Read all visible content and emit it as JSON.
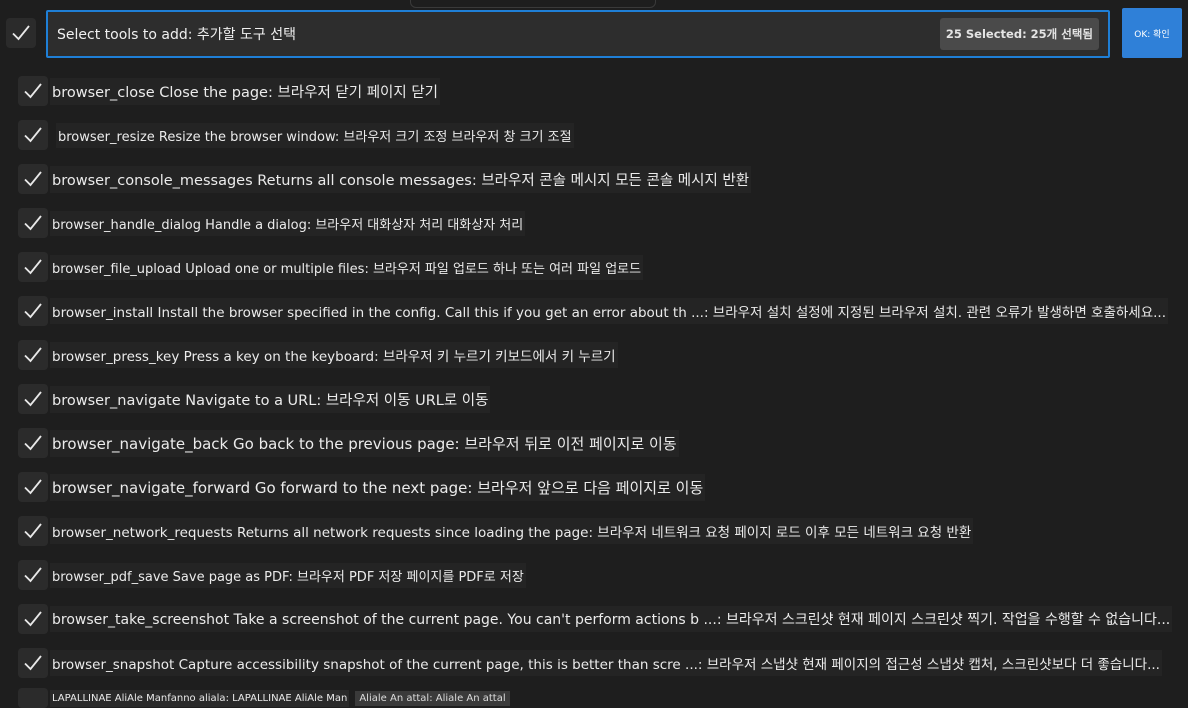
{
  "header": {
    "search_value": "Select tools to add: 추가할 도구 선택",
    "selected_badge": "25 Selected: 25개 선택됨",
    "ok_label": "OK: 확인"
  },
  "tools": [
    {
      "label": "browser_close Close the page: 브라우저 닫기 페이지 닫기"
    },
    {
      "label": "browser_resize Resize the browser window: 브라우저 크기 조정 브라우저 창 크기 조절"
    },
    {
      "label": "browser_console_messages Returns all console messages: 브라우저 콘솔 메시지 모든 콘솔 메시지 반환"
    },
    {
      "label": "browser_handle_dialog Handle a dialog: 브라우저 대화상자 처리 대화상자 처리"
    },
    {
      "label": "browser_file_upload Upload one or multiple files: 브라우저 파일 업로드 하나 또는 여러 파일 업로드"
    },
    {
      "label": "browser_install Install the browser specified in the config. Call this if you get an error about th ...: 브라우저 설치 설정에 지정된 브라우저 설치. 관련 오류가 발생하면 호출하세요..."
    },
    {
      "label": "browser_press_key Press a key on the keyboard: 브라우저 키 누르기 키보드에서 키 누르기"
    },
    {
      "label": "browser_navigate Navigate to a URL: 브라우저 이동 URL로 이동"
    },
    {
      "label": "browser_navigate_back Go back to the previous page: 브라우저 뒤로 이전 페이지로 이동"
    },
    {
      "label": "browser_navigate_forward Go forward to the next page: 브라우저 앞으로 다음 페이지로 이동"
    },
    {
      "label": "browser_network_requests Returns all network requests since loading the page: 브라우저 네트워크 요청 페이지 로드 이후 모든 네트워크 요청 반환"
    },
    {
      "label": "browser_pdf_save Save page as PDF: 브라우저 PDF 저장 페이지를 PDF로 저장"
    },
    {
      "label": "browser_take_screenshot Take a screenshot of the current page. You can't perform actions b ...: 브라우저 스크린샷 현재 페이지 스크린샷 찍기. 작업을 수행할 수 없습니다..."
    },
    {
      "label": "browser_snapshot Capture accessibility snapshot of the current page, this is better than scre ...: 브라우저 스냅샷 현재 페이지의 접근성 스냅샷 캡처, 스크린샷보다 더 좋습니다..."
    }
  ],
  "footer": {
    "partial_label": "LAPALLINAE AliAle Manfanno aliala: LAPALLINAE AliAle Man",
    "partial_extra": "Aliale An attal: Aliale An attal"
  },
  "colors": {
    "accent": "#2f80d8",
    "background": "#1e1e1e"
  }
}
